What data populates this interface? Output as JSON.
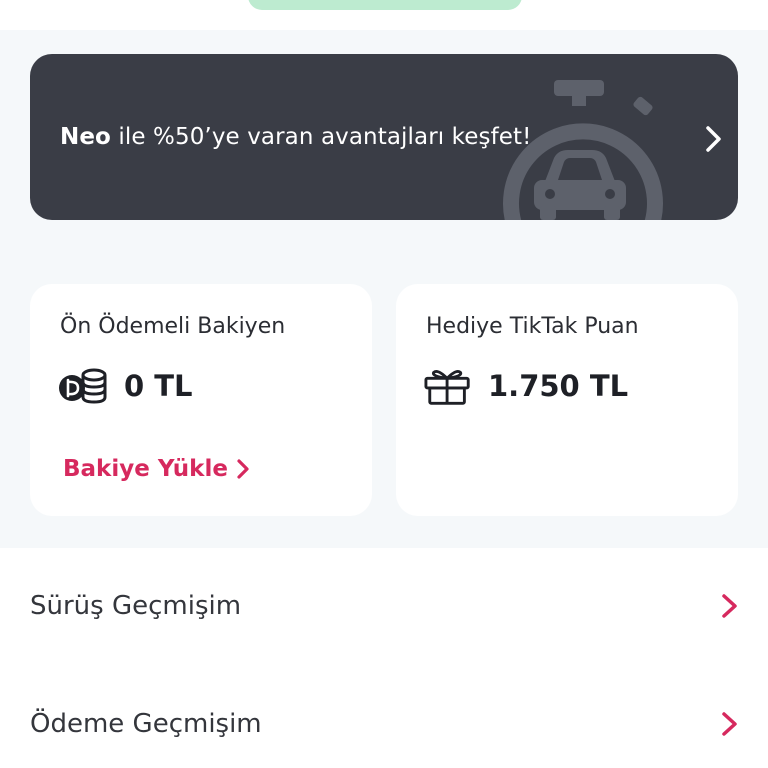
{
  "promo": {
    "brand": "Neo",
    "text": " ile %50’ye varan avantajları keşfet!",
    "icon": "stopwatch-car-icon",
    "action_icon": "chevron-right-icon"
  },
  "cards": {
    "prepaid": {
      "label": "Ön Ödemeli Bakiyen",
      "value": "0 TL",
      "icon": "coins-icon",
      "action_label": "Bakiye Yükle",
      "action_icon": "chevron-right-icon"
    },
    "gift": {
      "label": "Hediye TikTak Puan",
      "value": "1.750 TL",
      "icon": "gift-icon"
    }
  },
  "menu": {
    "items": [
      {
        "label": "Sürüş Geçmişim",
        "icon": "chevron-right-icon"
      },
      {
        "label": "Ödeme Geçmişim",
        "icon": "chevron-right-icon"
      }
    ]
  },
  "colors": {
    "background": "#f5f8fa",
    "promo_bg": "#3a3d46",
    "accent": "#d6295e",
    "top_pill": "#bdebd0"
  }
}
